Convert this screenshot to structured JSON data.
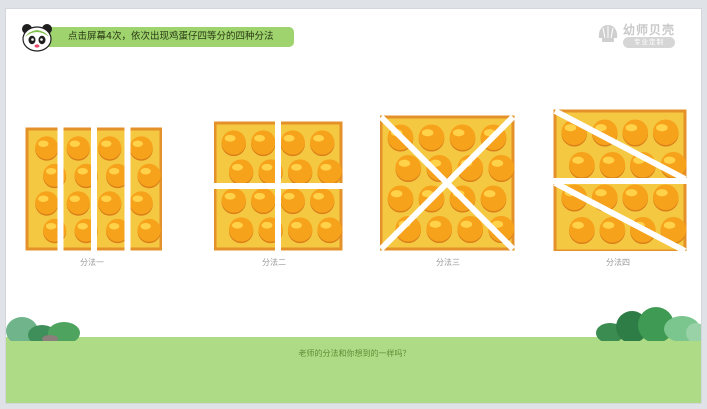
{
  "instruction": "点击屏幕4次，依次出现鸡蛋仔四等分的四种分法",
  "logo": {
    "name": "幼师贝壳",
    "sub": "专业定制"
  },
  "methods": [
    {
      "label": "分法一"
    },
    {
      "label": "分法二"
    },
    {
      "label": "分法三"
    },
    {
      "label": "分法四"
    }
  ],
  "question": "老师的分法和你想到的一样吗？",
  "colors": {
    "pill": "#9ed36e",
    "ground": "#aedb86",
    "waffle": "#f5c842",
    "bubble": "#f7a21b",
    "cut": "#ffffff"
  },
  "icons": {
    "mascot": "panda-icon",
    "brand": "shell-logo-icon"
  }
}
